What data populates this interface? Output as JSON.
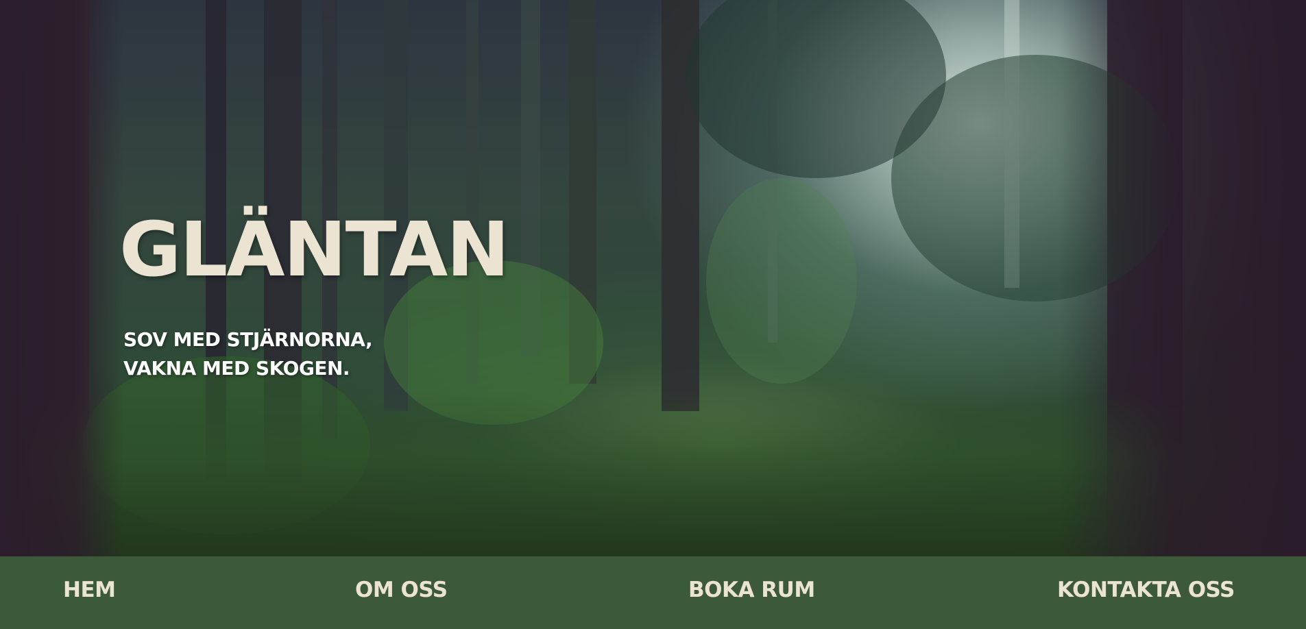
{
  "hero": {
    "title": "GLÄNTAN",
    "tagline_line1": "SOV MED STJÄRNORNA,",
    "tagline_line2": "VAKNA MED SKOGEN."
  },
  "nav": {
    "items": [
      {
        "label": "HEM"
      },
      {
        "label": "OM OSS"
      },
      {
        "label": "BOKA RUM"
      },
      {
        "label": "KONTAKTA OSS"
      }
    ]
  },
  "colors": {
    "nav_background": "#3c5a39",
    "nav_text": "#ece4d2",
    "title_text": "#ece4d2",
    "tagline_text": "#ffffff"
  }
}
